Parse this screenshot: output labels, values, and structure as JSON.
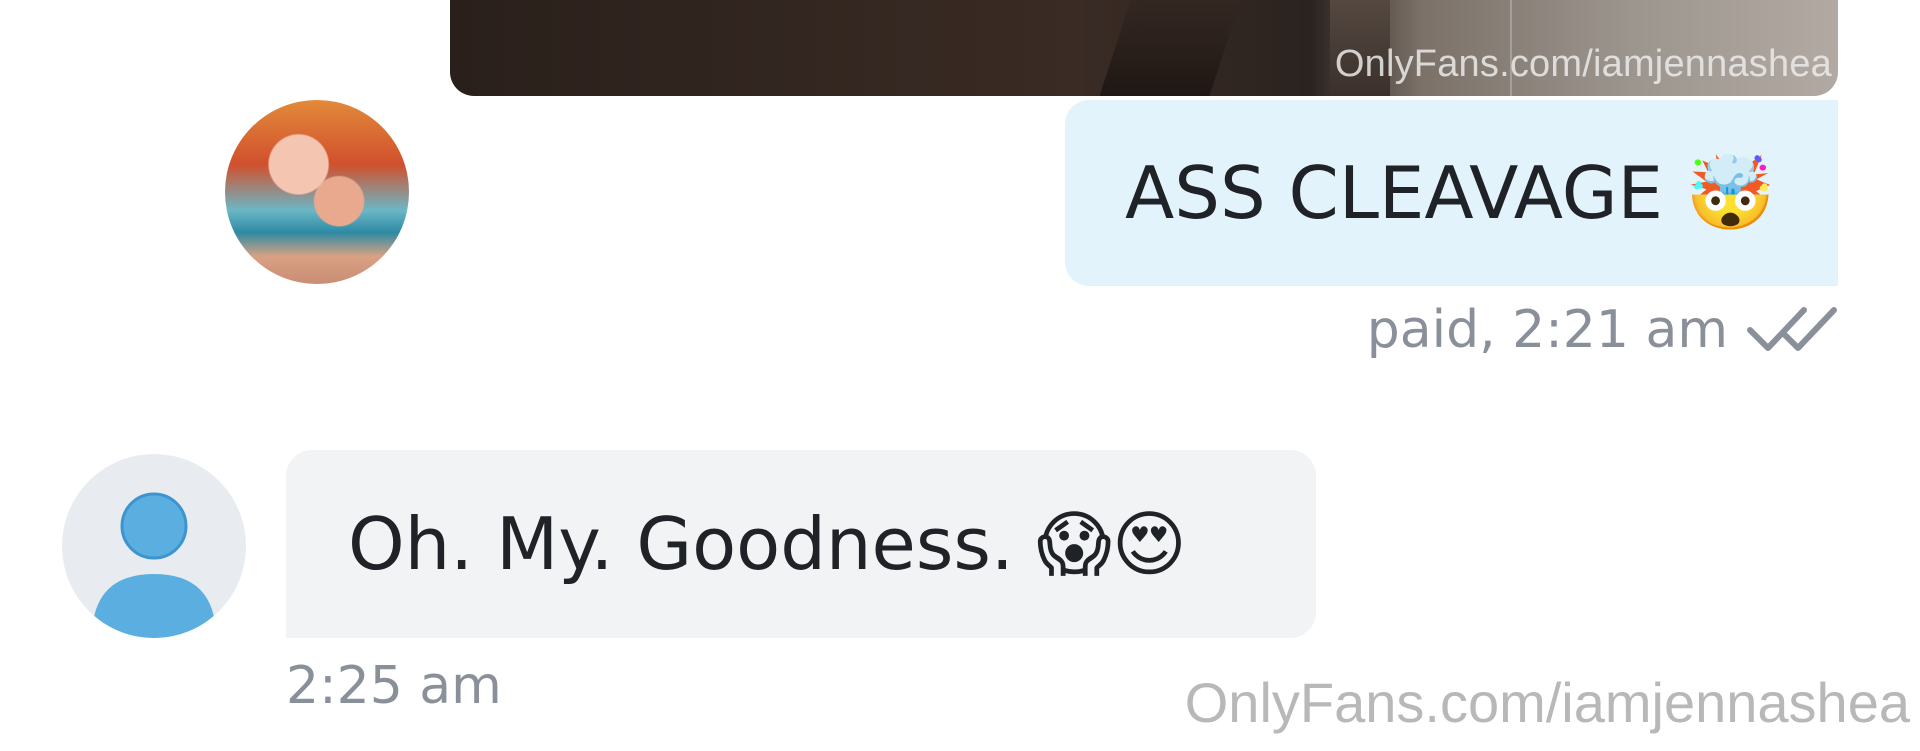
{
  "media": {
    "watermark": "OnlyFans.com/iamjennashea"
  },
  "messages": [
    {
      "direction": "sent",
      "text": "ASS CLEAVAGE 🤯",
      "meta": "paid, 2:21 am",
      "status_icon": "double-check-icon"
    },
    {
      "direction": "received",
      "text": "Oh. My. Goodness. 😱😍",
      "time": "2:25 am"
    }
  ],
  "page_watermark": "OnlyFans.com/iamjennashea",
  "colors": {
    "sent_bubble": "#e3f3fc",
    "received_bubble": "#f2f3f5",
    "meta_text": "#8a9099",
    "avatar_icon": "#5aaee0"
  }
}
